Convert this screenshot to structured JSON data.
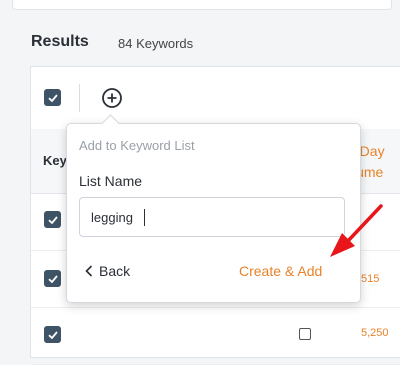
{
  "results": {
    "title": "Results",
    "count": "84 Keywords"
  },
  "table": {
    "keyword_header": "Keyword",
    "volume_header_line1": "Day",
    "volume_header_line2": "lume",
    "rows": [
      {
        "value": "",
        "keyword": ""
      },
      {
        "value": "515",
        "keyword": ""
      },
      {
        "value": "5,250",
        "keyword": ""
      }
    ]
  },
  "popover": {
    "title": "Add to Keyword List",
    "label": "List Name",
    "input_value": "legging",
    "back_label": "Back",
    "create_label": "Create & Add"
  },
  "colors": {
    "accent": "#e8832a",
    "checkbox": "#3f5366",
    "annotation_arrow": "#e8151b"
  },
  "icons": {
    "add": "plus-circle-icon",
    "back": "chevron-left-icon",
    "check": "check-icon"
  }
}
